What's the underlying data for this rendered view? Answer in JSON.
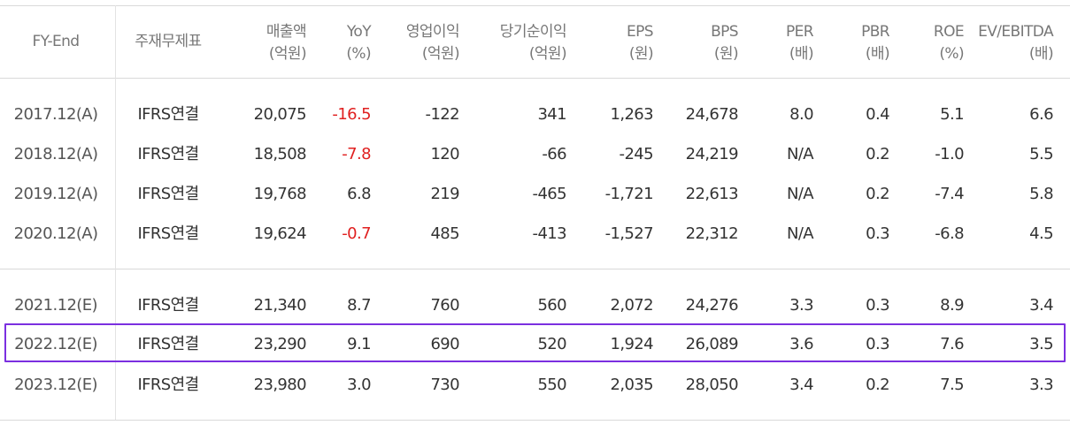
{
  "headers": [
    {
      "key": "fy_end",
      "line1": "FY-End",
      "line2": ""
    },
    {
      "key": "basis",
      "line1": "주재무제표",
      "line2": ""
    },
    {
      "key": "revenue",
      "line1": "매출액",
      "line2": "(억원)"
    },
    {
      "key": "yoy",
      "line1": "YoY",
      "line2": "(%)"
    },
    {
      "key": "op_income",
      "line1": "영업이익",
      "line2": "(억원)"
    },
    {
      "key": "net_income",
      "line1": "당기순이익",
      "line2": "(억원)"
    },
    {
      "key": "eps",
      "line1": "EPS",
      "line2": "(원)"
    },
    {
      "key": "bps",
      "line1": "BPS",
      "line2": "(원)"
    },
    {
      "key": "per",
      "line1": "PER",
      "line2": "(배)"
    },
    {
      "key": "pbr",
      "line1": "PBR",
      "line2": "(배)"
    },
    {
      "key": "roe",
      "line1": "ROE",
      "line2": "(%)"
    },
    {
      "key": "ev_ebitda",
      "line1": "EV/EBITDA",
      "line2": "(배)"
    }
  ],
  "rows": [
    {
      "cells": [
        "2017.12(A)",
        "IFRS연결",
        "20,075",
        "-16.5",
        "-122",
        "341",
        "1,263",
        "24,678",
        "8.0",
        "0.4",
        "5.1",
        "6.6"
      ],
      "yoy_negative_red": true,
      "highlighted": false
    },
    {
      "cells": [
        "2018.12(A)",
        "IFRS연결",
        "18,508",
        "-7.8",
        "120",
        "-66",
        "-245",
        "24,219",
        "N/A",
        "0.2",
        "-1.0",
        "5.5"
      ],
      "yoy_negative_red": true,
      "highlighted": false
    },
    {
      "cells": [
        "2019.12(A)",
        "IFRS연결",
        "19,768",
        "6.8",
        "219",
        "-465",
        "-1,721",
        "22,613",
        "N/A",
        "0.2",
        "-7.4",
        "5.8"
      ],
      "yoy_negative_red": false,
      "highlighted": false
    },
    {
      "cells": [
        "2020.12(A)",
        "IFRS연결",
        "19,624",
        "-0.7",
        "485",
        "-413",
        "-1,527",
        "22,312",
        "N/A",
        "0.3",
        "-6.8",
        "4.5"
      ],
      "yoy_negative_red": true,
      "highlighted": false
    },
    {
      "cells": [
        "2021.12(E)",
        "IFRS연결",
        "21,340",
        "8.7",
        "760",
        "560",
        "2,072",
        "24,276",
        "3.3",
        "0.3",
        "8.9",
        "3.4"
      ],
      "yoy_negative_red": false,
      "highlighted": false
    },
    {
      "cells": [
        "2022.12(E)",
        "IFRS연결",
        "23,290",
        "9.1",
        "690",
        "520",
        "1,924",
        "26,089",
        "3.6",
        "0.3",
        "7.6",
        "3.5"
      ],
      "yoy_negative_red": false,
      "highlighted": true
    },
    {
      "cells": [
        "2023.12(E)",
        "IFRS연결",
        "23,980",
        "3.0",
        "730",
        "550",
        "2,035",
        "28,050",
        "3.4",
        "0.2",
        "7.5",
        "3.3"
      ],
      "yoy_negative_red": false,
      "highlighted": false
    }
  ],
  "colors": {
    "negative": "#e02020",
    "highlight_border": "#7b2fe0",
    "header_text": "#777777",
    "body_text": "#333333"
  }
}
